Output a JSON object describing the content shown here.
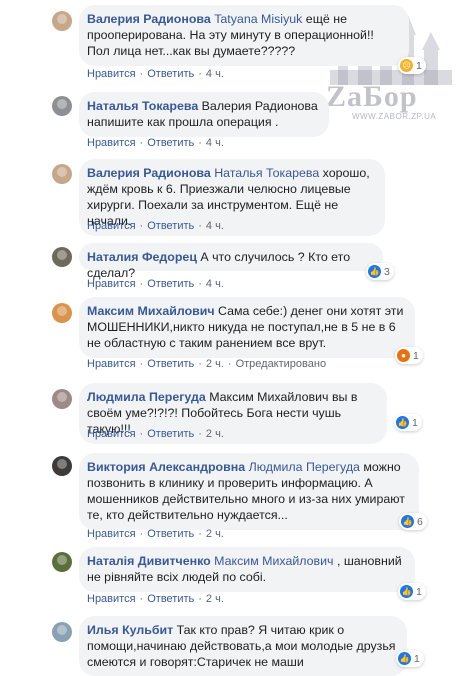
{
  "comments": [
    {
      "author": "Валерия Радионова",
      "mention": "Tatyana Misiyuk",
      "text": " ещё не прооперирована. На эту минуту в операционной!! Пол лица нет...как вы думаете?????",
      "like_label": "Нравится",
      "reply_label": "Ответить",
      "time": "4 ч.",
      "reaction_count": "1",
      "reaction_icon": "sad-reaction-icon"
    },
    {
      "author": "Наталья Токарева",
      "mention": "Валерия Радионова",
      "text": " напишите как прошла операция .",
      "like_label": "Нравится",
      "reply_label": "Ответить",
      "time": "4 ч."
    },
    {
      "author": "Валерия Радионова",
      "mention": "Наталья Токарева",
      "text": " хорошо, ждём кровь к 6. Приезжали челюсно лицевые хирурги. Поехали за инструментом. Ещё не начали.",
      "like_label": "Нравится",
      "reply_label": "Ответить",
      "time": "4 ч."
    },
    {
      "author": "Наталия Федорец",
      "mention": "",
      "text": " А что случилось ? Кто ето сделал?",
      "like_label": "Нравится",
      "reply_label": "Ответить",
      "time": "4 ч.",
      "reaction_count": "3",
      "reaction_icon": "like-reaction-icon"
    },
    {
      "author": "Максим Михайлович",
      "mention": "",
      "text": " Сама себе:) денег они хотят эти МОШЕННИКИ,никто никуда не поступал,не в 5 не в 6 не областную с таким ранением все врут.",
      "like_label": "Нравится",
      "reply_label": "Ответить",
      "time": "2 ч.",
      "edited": "Отредактировано",
      "reaction_count": "1",
      "reaction_icon": "angry-reaction-icon"
    },
    {
      "author": "Людмила Перегуда",
      "mention": "Максим Михайлович",
      "text": " вы в своём уме?!?!?! Побойтесь Бога нести чушь такую!!!",
      "like_label": "Нравится",
      "reply_label": "Ответить",
      "time": "2 ч.",
      "reaction_count": "1",
      "reaction_icon": "like-reaction-icon"
    },
    {
      "author": "Виктория Александровна",
      "mention": "Людмила Перегуда",
      "text": " можно позвонить в клинику и проверить информацию. А мошенников действительно много и из-за них умирают те, кто действительно нуждается...",
      "like_label": "Нравится",
      "reply_label": "Ответить",
      "time": "2 ч.",
      "reaction_count": "6",
      "reaction_icon": "like-reaction-icon"
    },
    {
      "author": "Наталія Дивитченко",
      "mention": "Максим Михайлович",
      "text": " , шановний не рівняйте всіх людей по собі.",
      "like_label": "Нравится",
      "reply_label": "Ответить",
      "time": "2 ч.",
      "reaction_count": "1",
      "reaction_icon": "like-reaction-icon"
    },
    {
      "author": "Илья Кульбит",
      "mention": "",
      "text": " Так кто прав? Я читаю крик о помощи,начинаю действовать,а мои молодые друзья смеются и говорят:Старичек не маши",
      "reaction_count": "1",
      "reaction_icon": "like-reaction-icon"
    }
  ],
  "watermark": {
    "logo_text": "ZaБор",
    "url": "WWW.ZABOR.ZP.UA"
  },
  "colors": {
    "author": "#385898",
    "bubble": "#f2f3f5",
    "like": "#1877f2",
    "angry": "#e9710f",
    "sad": "#f7b125"
  }
}
